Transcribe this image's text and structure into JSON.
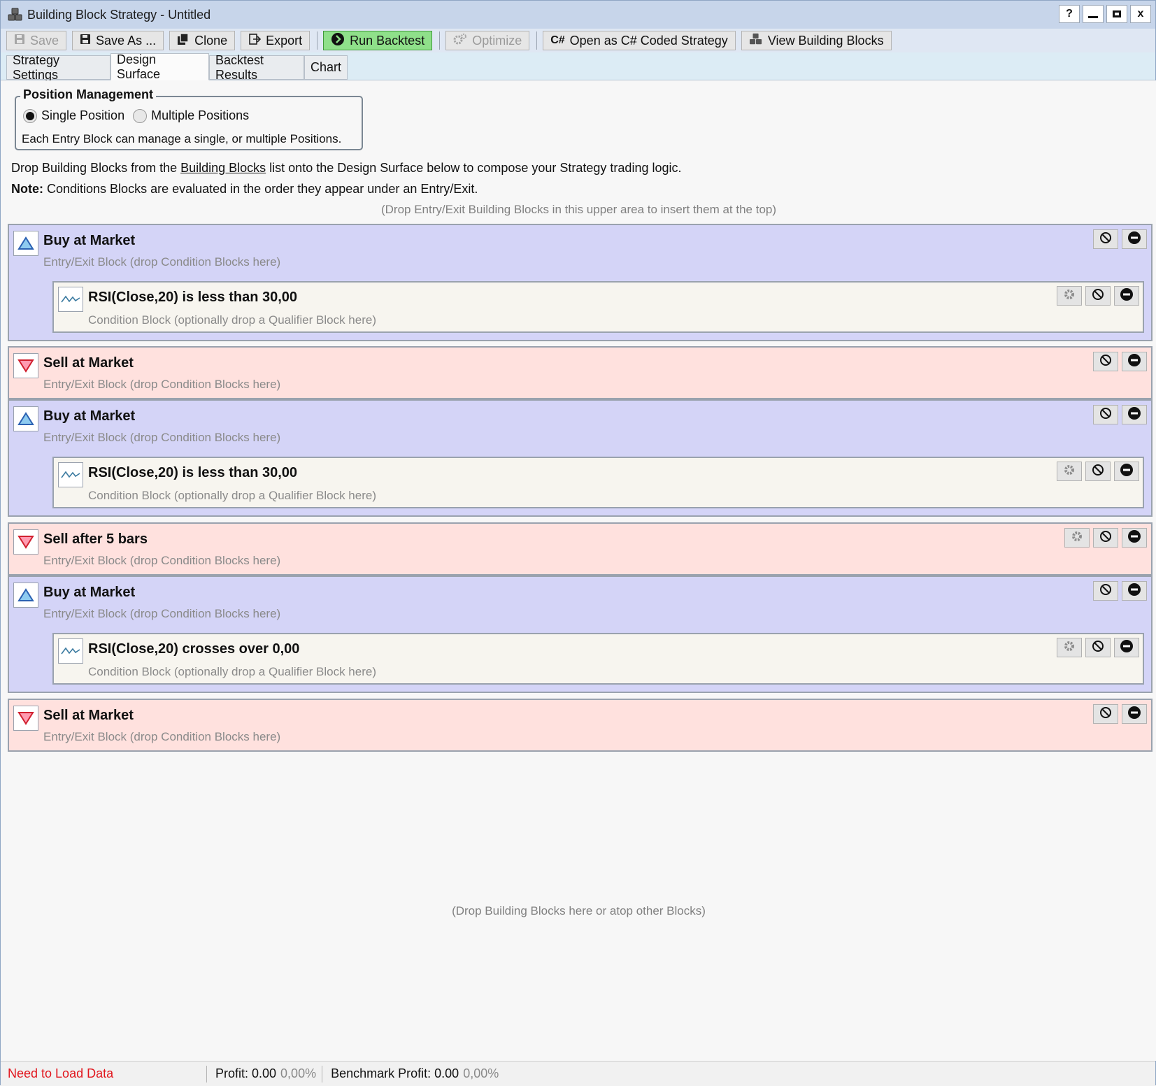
{
  "window": {
    "title": "Building Block Strategy - Untitled",
    "controls": {
      "help": "?",
      "close": "x"
    }
  },
  "toolbar": {
    "save": "Save",
    "save_as": "Save As ...",
    "clone": "Clone",
    "export": "Export",
    "run_backtest": "Run Backtest",
    "optimize": "Optimize",
    "open_csharp": "Open as C# Coded Strategy",
    "csharp_icon_text": "C#",
    "view_blocks": "View Building Blocks"
  },
  "tabs": [
    {
      "label": "Strategy Settings"
    },
    {
      "label": "Design Surface"
    },
    {
      "label": "Backtest Results"
    },
    {
      "label": "Chart"
    }
  ],
  "position_management": {
    "title": "Position Management",
    "single": "Single Position",
    "multiple": "Multiple Positions",
    "note": "Each Entry Block can manage a single, or multiple Positions."
  },
  "info": {
    "line1_a": "Drop Building Blocks from the ",
    "line1_link": "Building Blocks",
    "line1_b": " list onto the Design Surface below to compose your Strategy trading logic.",
    "line2_bold": "Note:",
    "line2_rest": " Conditions Blocks are evaluated in the order they appear under an Entry/Exit.",
    "drop_top": "(Drop Entry/Exit Building Blocks in this upper area to insert them at the top)",
    "drop_bottom": "(Drop Building Blocks here or atop other Blocks)"
  },
  "blocks": [
    {
      "type": "buy",
      "title": "Buy at Market",
      "subtitle": "Entry/Exit Block (drop Condition Blocks here)"
    },
    {
      "type": "cond",
      "title": "RSI(Close,20) is less than 30,00",
      "subtitle": "Condition Block (optionally drop a Qualifier Block here)"
    },
    {
      "type": "sell",
      "title": "Sell at Market",
      "subtitle": "Entry/Exit Block (drop Condition Blocks here)"
    },
    {
      "type": "buy",
      "title": "Buy at Market",
      "subtitle": "Entry/Exit Block (drop Condition Blocks here)"
    },
    {
      "type": "cond",
      "title": "RSI(Close,20) is less than 30,00",
      "subtitle": "Condition Block (optionally drop a Qualifier Block here)"
    },
    {
      "type": "sell",
      "title": "Sell after 5 bars",
      "subtitle": "Entry/Exit Block (drop Condition Blocks here)"
    },
    {
      "type": "buy",
      "title": "Buy at Market",
      "subtitle": "Entry/Exit Block (drop Condition Blocks here)"
    },
    {
      "type": "cond",
      "title": "RSI(Close,20) crosses over 0,00",
      "subtitle": "Condition Block (optionally drop a Qualifier Block here)"
    },
    {
      "type": "sell",
      "title": "Sell at Market",
      "subtitle": "Entry/Exit Block (drop Condition Blocks here)"
    }
  ],
  "status": {
    "load": "Need to Load Data",
    "profit_label": "Profit: 0.00",
    "profit_pct": "0,00%",
    "bench_label": "Benchmark Profit: 0.00",
    "bench_pct": "0,00%"
  },
  "colors": {
    "buy_bg": "#d4d4f7",
    "sell_bg": "#ffe1de",
    "cond_bg": "#f7f5ef",
    "run_bg": "#8fe08a",
    "status_error": "#e1161d"
  }
}
